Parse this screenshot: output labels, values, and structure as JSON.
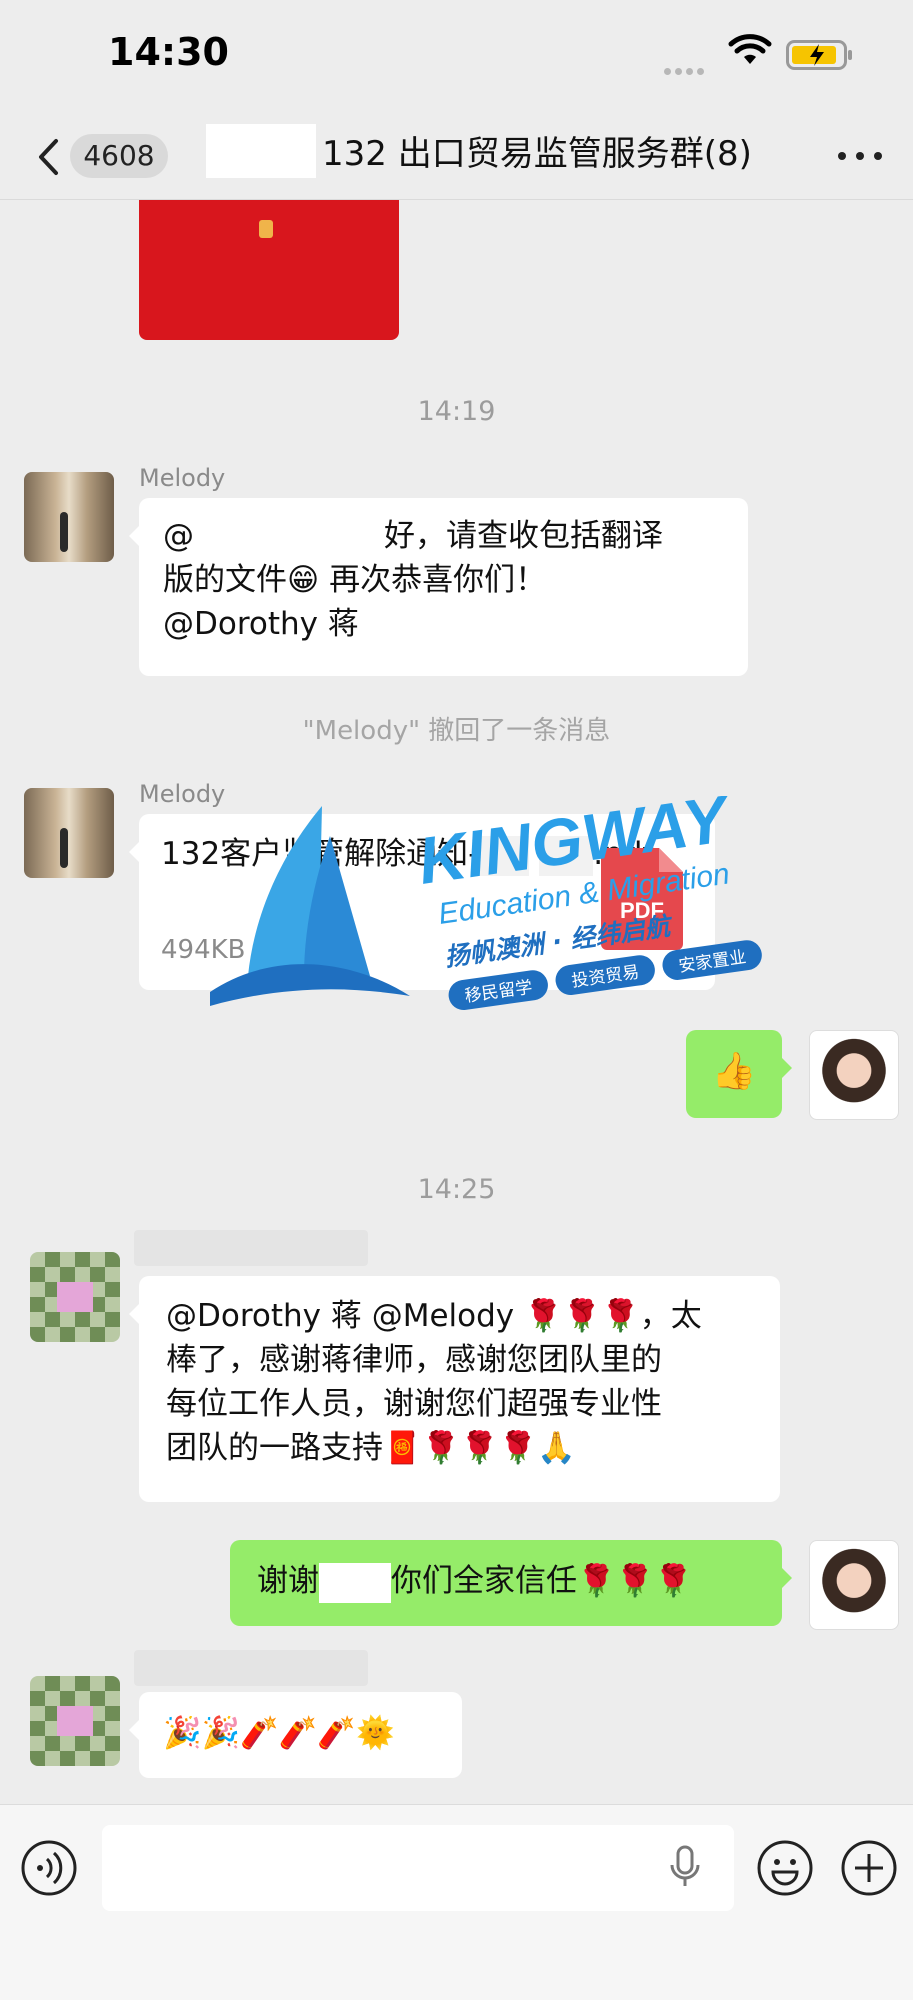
{
  "status_bar": {
    "time": "14:30"
  },
  "nav": {
    "unread_count": "4608",
    "title": "132 出口贸易监管服务群(8)"
  },
  "messages": {
    "ts1": "14:19",
    "sender1": "Melody",
    "msg1_line1_prefix": "@",
    "msg1_line1_suffix": "好，请查收包括翻译",
    "msg1_line2": "版的文件😁 再次恭喜你们！",
    "msg1_line3": "@Dorothy 蒋",
    "recall": "\"Melody\" 撤回了一条消息",
    "sender2": "Melody",
    "file_name_line1": "132客户监管解除通知-",
    "file_name_line2": ".pdf",
    "file_meta": "494KB  未下载",
    "pdf_label": "PDF",
    "msg_thumbs": "👍",
    "ts2": "14:25",
    "msg3_line1": "@Dorothy 蒋 @Melody 🌹🌹🌹，太",
    "msg3_line2": "棒了，感谢蒋律师，感谢您团队里的",
    "msg3_line3": "每位工作人员，谢谢您们超强专业性",
    "msg3_line4": "团队的一路支持🧧🌹🌹🌹🙏",
    "msg4_prefix": "谢谢",
    "msg4_suffix": "你们全家信任🌹🌹🌹",
    "msg5": "🎉🎉🧨🧨🧨🌞"
  },
  "watermark": {
    "brand": "KINGWAY",
    "tagline": "Education & Migration",
    "slogan": "扬帆澳洲 · 经纬启航",
    "tag1": "移民留学",
    "tag2": "投资贸易",
    "tag3": "安家置业"
  }
}
